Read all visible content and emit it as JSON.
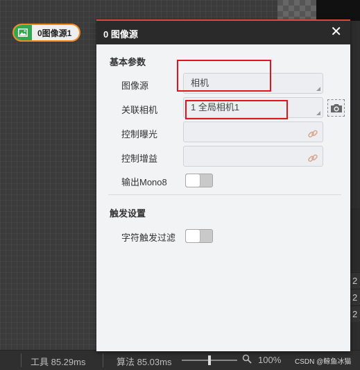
{
  "node": {
    "label": "0图像源1"
  },
  "dialog": {
    "title": "0 图像源",
    "close_label": "✕",
    "section_basic": "基本参数",
    "image_source": {
      "label": "图像源",
      "value": "相机"
    },
    "linked_camera": {
      "label": "关联相机",
      "value": "1 全局相机1"
    },
    "exposure_control": {
      "label": "控制曝光",
      "value": ""
    },
    "gain_control": {
      "label": "控制增益",
      "value": ""
    },
    "output_mono8": {
      "label": "输出Mono8",
      "enabled": false
    },
    "section_trigger": "触发设置",
    "char_trigger_filter": {
      "label": "字符触发过滤",
      "enabled": false
    }
  },
  "statusbar": {
    "tool_time": "工具 85.29ms",
    "algo_time": "算法 85.03ms",
    "zoom": "100%"
  },
  "right_panel": {
    "rows": [
      "2",
      "2",
      "2"
    ]
  },
  "watermark": "CSDN @鲸鱼冰猫",
  "colors": {
    "accent": "#e0463c",
    "node_border": "#f08a24",
    "node_icon_bg": "#31a84f",
    "highlight": "#e2141b"
  },
  "icons": {
    "node": "image-icon",
    "camera": "camera-icon",
    "link": "link-icon",
    "close": "close-icon",
    "zoom": "zoom-icon"
  }
}
